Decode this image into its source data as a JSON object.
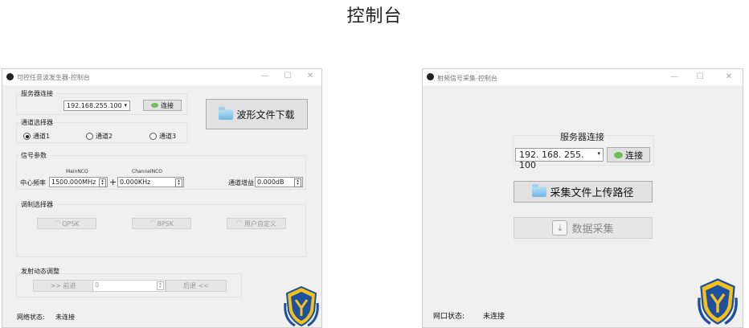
{
  "page_title": "控制台",
  "left_window": {
    "title": "可控任意波发生器-控制台",
    "server_group": "服务器连接",
    "ip": "192.168.255.100",
    "connect_label": "连接",
    "download_label": "波形文件下载",
    "channel_group": "通道选择器",
    "channels": [
      "通道1",
      "通道2",
      "通道3"
    ],
    "selected_channel": "通道1",
    "signal_group": "信号参数",
    "center_freq_label": "中心频率",
    "main_nco_label": "MainNCO",
    "main_nco_value": "1500.000MHz",
    "plus": "+",
    "channel_nco_label": "ChannelNCO",
    "channel_nco_value": "0.000KHz",
    "gain_label": "通道增益",
    "gain_value": "0.000dB",
    "mod_group": "调制选择器",
    "mod_buttons": [
      "QPSK",
      "8PSK",
      "用户自定义"
    ],
    "emit_group": "发射动态调整",
    "forward_label": ">> 前进",
    "step_value": "0",
    "back_label": "后退 <<",
    "status_label": "网络状态:",
    "status_value": "未连接"
  },
  "right_window": {
    "title": "射频信号采集-控制台",
    "server_group": "服务器连接",
    "ip": "192. 168. 255. 100",
    "connect_label": "连接",
    "upload_label": "采集文件上传路径",
    "collect_label": "数据采集",
    "status_label": "网口状态:",
    "status_value": "未连接"
  },
  "window_controls": {
    "minimize": "—",
    "maximize": "☐",
    "close": "✕"
  },
  "colors": {
    "window_bg": "#f0f0f0",
    "led": "#6cbf55",
    "badge_blue": "#1e4fa0",
    "badge_gold": "#f2c21b"
  }
}
